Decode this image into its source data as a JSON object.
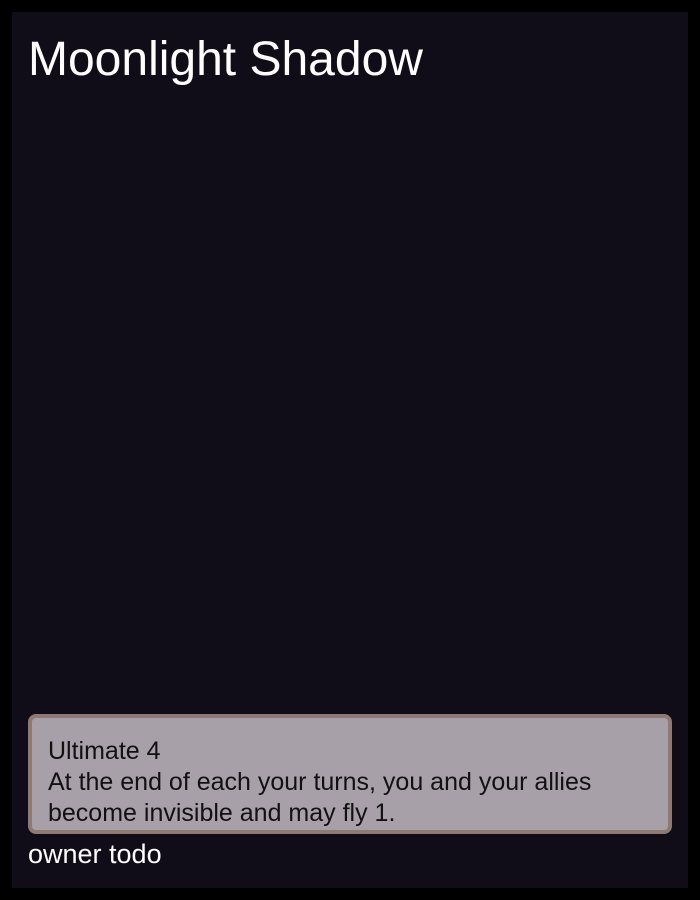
{
  "card": {
    "title": "Moonlight Shadow",
    "ability": {
      "name": "Ultimate 4",
      "text": "At the end of each your turns, you and your allies become invisible and may fly 1."
    },
    "owner": "owner todo"
  },
  "colors": {
    "page_background": "#000000",
    "card_background": "#110d18",
    "ability_box_background": "#a8a0a8",
    "ability_box_border": "#8e7a72",
    "title_text": "#ffffff"
  }
}
